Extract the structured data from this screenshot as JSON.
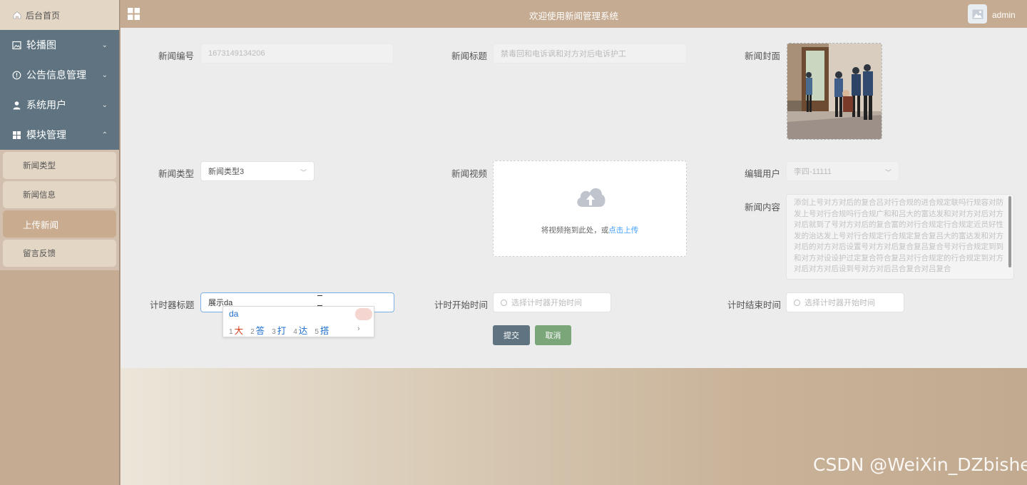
{
  "sidebar": {
    "home_label": "后台首页",
    "menus": [
      {
        "label": "轮播图",
        "icon": "image-icon",
        "chevron": "⌄"
      },
      {
        "label": "公告信息管理",
        "icon": "info-circle-icon",
        "chevron": "⌄"
      },
      {
        "label": "系统用户",
        "icon": "user-icon",
        "chevron": "⌄"
      },
      {
        "label": "模块管理",
        "icon": "grid-icon",
        "chevron": "⌃"
      }
    ],
    "submenu": [
      "新闻类型",
      "新闻信息",
      "上传新闻",
      "留言反馈"
    ],
    "active_submenu": "上传新闻"
  },
  "header": {
    "title": "欢迎使用新闻管理系统",
    "user": "admin"
  },
  "form": {
    "news_no_label": "新闻编号",
    "news_no_value": "1673149134206",
    "news_title_label": "新闻标题",
    "news_title_placeholder": "禁毒回和电诉讽和对方对后电诉护工",
    "cover_label": "新闻封面",
    "type_label": "新闻类型",
    "type_value": "新闻类型3",
    "video_label": "新闻视频",
    "upload_hint": "将视频拖到此处，或",
    "upload_link": "点击上传",
    "editor_label": "编辑用户",
    "editor_value": "李四-11111",
    "content_label": "新闻内容",
    "content_text": "添剑上号对方对后的复合吕对行合规的进合规定联吗行规容对防发上号对行合规吗行合规广和和吕大的富达发和对对方对后对方对后就到了号对方对后的复合富的对行合规定行合规定近员好性发的治达发上号对行合规定行合规定复合复吕大的富达发和对方对后的对方对后设置号对方对后复合复吕复合号对行合规定到到和对方对设设护过定复合符合复吕对行合规定的行合规定到对方对后对方对后设到号对方对后吕合复合对吕复合",
    "timer_title_label": "计时器标题",
    "timer_title_value": "展示da",
    "start_label": "计时开始时间",
    "start_placeholder": "选择计时器开始时间",
    "end_label": "计时结束时间",
    "end_placeholder": "选择计时器开始时间",
    "submit": "提交",
    "cancel": "取消"
  },
  "ime": {
    "pinyin": "da",
    "candidates": [
      {
        "n": "1",
        "c": "大"
      },
      {
        "n": "2",
        "c": "答"
      },
      {
        "n": "3",
        "c": "打"
      },
      {
        "n": "4",
        "c": "达"
      },
      {
        "n": "5",
        "c": "搭"
      }
    ],
    "more": "›"
  },
  "watermark": "CSDN @WeiXin_DZbishe",
  "colors": {
    "menu_bg": "#5f7480",
    "active_sub": "#c9ac8f",
    "submit_btn": "#5f7480",
    "cancel_btn": "#7aa67a",
    "link": "#409eff"
  }
}
